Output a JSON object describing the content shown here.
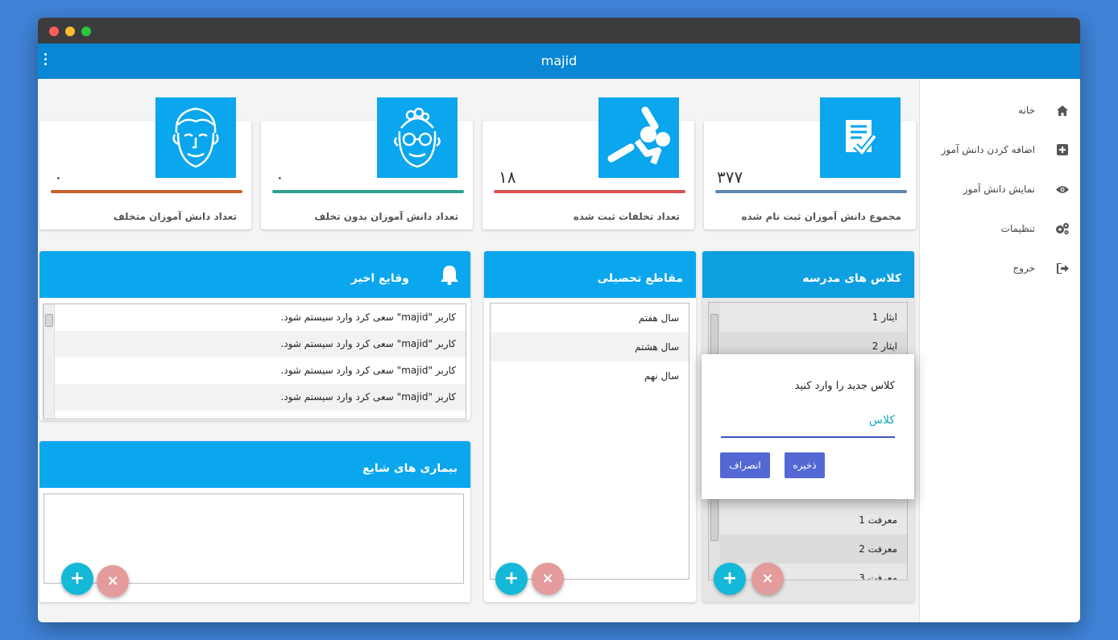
{
  "window": {
    "title": "majid"
  },
  "sidebar": {
    "items": [
      {
        "label": "خانه",
        "icon": "home-icon"
      },
      {
        "label": "اضافه کردن دانش آموز",
        "icon": "plus-square-icon"
      },
      {
        "label": "نمایش دانش آموز",
        "icon": "eye-icon"
      },
      {
        "label": "تنظیمات",
        "icon": "gears-icon"
      },
      {
        "label": "خروج",
        "icon": "sign-out-icon"
      }
    ]
  },
  "stats": [
    {
      "label": "مجموع دانش آموزان ثبت نام شده",
      "value": "۳۷۷",
      "color": "#5b87b0",
      "icon": "registration-icon"
    },
    {
      "label": "تعداد تخلفات ثبت شده",
      "value": "۱۸",
      "color": "#d9534f",
      "icon": "violation-icon"
    },
    {
      "label": "تعداد دانش آموزان بدون تخلف",
      "value": "۰",
      "color": "#2ea38e",
      "icon": "old-man-face-icon"
    },
    {
      "label": "تعداد دانش آموزان متخلف",
      "value": "۰",
      "color": "#c8622a",
      "icon": "man-face-icon"
    }
  ],
  "classes_panel": {
    "title": "کلاس های مدرسه",
    "items": [
      "ایثار 1",
      "ایثار 2",
      "معرفت 1",
      "معرفت 2",
      "معرفت 3"
    ]
  },
  "grades_panel": {
    "title": "مقاطع تحصیلی",
    "items": [
      "سال هفتم",
      "سال هشتم",
      "سال نهم"
    ]
  },
  "events_panel": {
    "title": "وقایع اخیر",
    "items": [
      "کاربر \"majid\" سعی کرد وارد سیستم شود.",
      "کاربر \"majid\" سعی کرد وارد سیستم شود.",
      "کاربر \"majid\" سعی کرد وارد سیستم شود.",
      "کاربر \"majid\" سعی کرد وارد سیستم شود."
    ]
  },
  "diseases_panel": {
    "title": "بیماری های شایع"
  },
  "fab": {
    "add": "+",
    "delete": "×"
  },
  "dialog": {
    "title": "کلاس جدید را وارد کنید",
    "input_value": "کلاس",
    "save_label": "ذخیره",
    "cancel_label": "انصراف"
  },
  "colors": {
    "accent": "#0aa6ee",
    "appbar": "#0a87d4",
    "button": "#5468d4"
  }
}
